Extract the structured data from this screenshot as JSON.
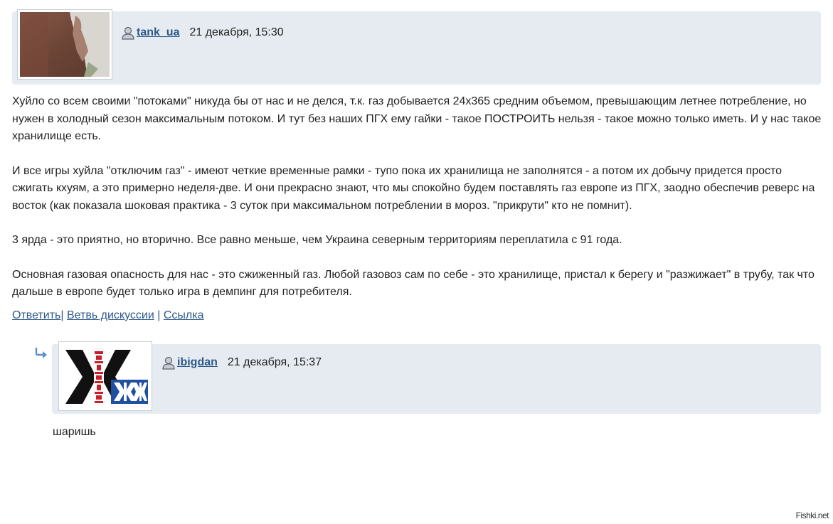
{
  "comment1": {
    "username": "tank_ua",
    "timestamp": "21 декабря, 15:30",
    "paragraphs": [
      "Хуйло со всем своими \"потоками\" никуда бы от нас и не делся, т.к. газ добывается 24х365 средним объемом, превышающим летнее потребление, но нужен в холодный сезон максимальным потоком. И тут без наших ПГХ ему гайки - такое ПОСТРОИТЬ нельзя - такое можно только иметь. И у нас такое хранилище есть.",
      "И все игры хуйла \"отключим газ\" - имеют четкие временные рамки - тупо пока их хранилища не заполнятся - а потом их добычу придется просто сжигать кхуям, а это примерно неделя-две. И они прекрасно знают, что мы спокойно будем поставлять газ европе из ПГХ, заодно обеспечив реверс на восток (как показала шоковая практика - 3 суток при максимальном потреблении в мороз. \"прикрути\" кто не помнит).",
      "3 ярда - это приятно, но вторично. Все равно меньше, чем Украина северным территориям переплатила с 91 года.",
      "Основная газовая опасность для нас - это сжиженный газ. Любой газовоз сам по себе - это хранилище, пристал к берегу и \"разжижает\" в трубу, так что дальше в европе будет только игра в демпинг для потребителя."
    ],
    "actions": {
      "reply": "Ответить",
      "sep1": "|",
      "thread": "Ветвь дискуссии",
      "sep2": "|",
      "link": "Ссылка"
    }
  },
  "comment2": {
    "username": "ibigdan",
    "timestamp": "21 декабря, 15:37",
    "text": "шаришь"
  },
  "icons": {
    "user": "user-icon",
    "reply_arrow": "reply-arrow-icon",
    "avatar2_logo": "zhzh-logo"
  },
  "colors": {
    "link": "#2d5a8a",
    "header_bg": "#e6ebf1"
  },
  "watermark": "Fishki.net"
}
